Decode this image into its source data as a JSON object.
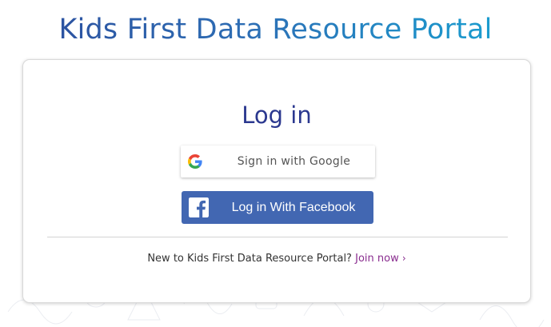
{
  "header": {
    "title": "Kids First Data Resource Portal"
  },
  "login_card": {
    "heading": "Log in",
    "google_button": {
      "label": "Sign in with Google",
      "icon": "google-icon"
    },
    "facebook_button": {
      "label": "Log in With Facebook",
      "icon": "facebook-icon",
      "color": "#4267b2"
    },
    "signup": {
      "prompt": "New to Kids First Data Resource Portal?",
      "link_label": "Join now",
      "chevron": "›"
    }
  },
  "colors": {
    "title_gradient_start": "#2b4b9b",
    "title_gradient_end": "#16a7d5",
    "heading": "#2b388f",
    "join_link": "#8a2d8f"
  }
}
